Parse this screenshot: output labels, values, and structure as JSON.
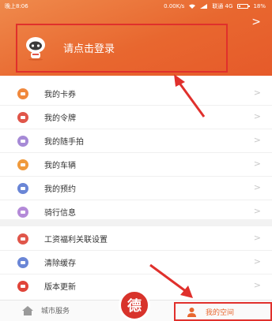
{
  "status_bar": {
    "time": "晚上8:06",
    "speed": "0.00K/s",
    "carrier": "联通 4G",
    "battery": "18%",
    "battery_level": 0.18
  },
  "header": {
    "login_text": "请点击登录",
    "chevron": ">"
  },
  "menu_group_1": [
    {
      "label": "我的卡券",
      "color": "#f0883c",
      "icon": "ticket-icon"
    },
    {
      "label": "我的令牌",
      "color": "#e0564a",
      "icon": "token-icon"
    },
    {
      "label": "我的随手拍",
      "color": "#a68ad6",
      "icon": "camera-icon"
    },
    {
      "label": "我的车辆",
      "color": "#f09a3c",
      "icon": "car-icon"
    },
    {
      "label": "我的预约",
      "color": "#6a86d6",
      "icon": "calendar-icon"
    },
    {
      "label": "骑行信息",
      "color": "#b48ad8",
      "icon": "bike-icon"
    }
  ],
  "menu_group_2": [
    {
      "label": "工资福利关联设置",
      "color": "#e0564a",
      "icon": "salary-icon"
    },
    {
      "label": "清除缓存",
      "color": "#6a86d6",
      "icon": "clear-icon"
    },
    {
      "label": "版本更新",
      "color": "#e0453a",
      "icon": "update-icon"
    }
  ],
  "menu_chevron": ">",
  "tabbar": {
    "city_label": "城市服务",
    "center_glyph": "德",
    "mine_label": "我的空间"
  }
}
